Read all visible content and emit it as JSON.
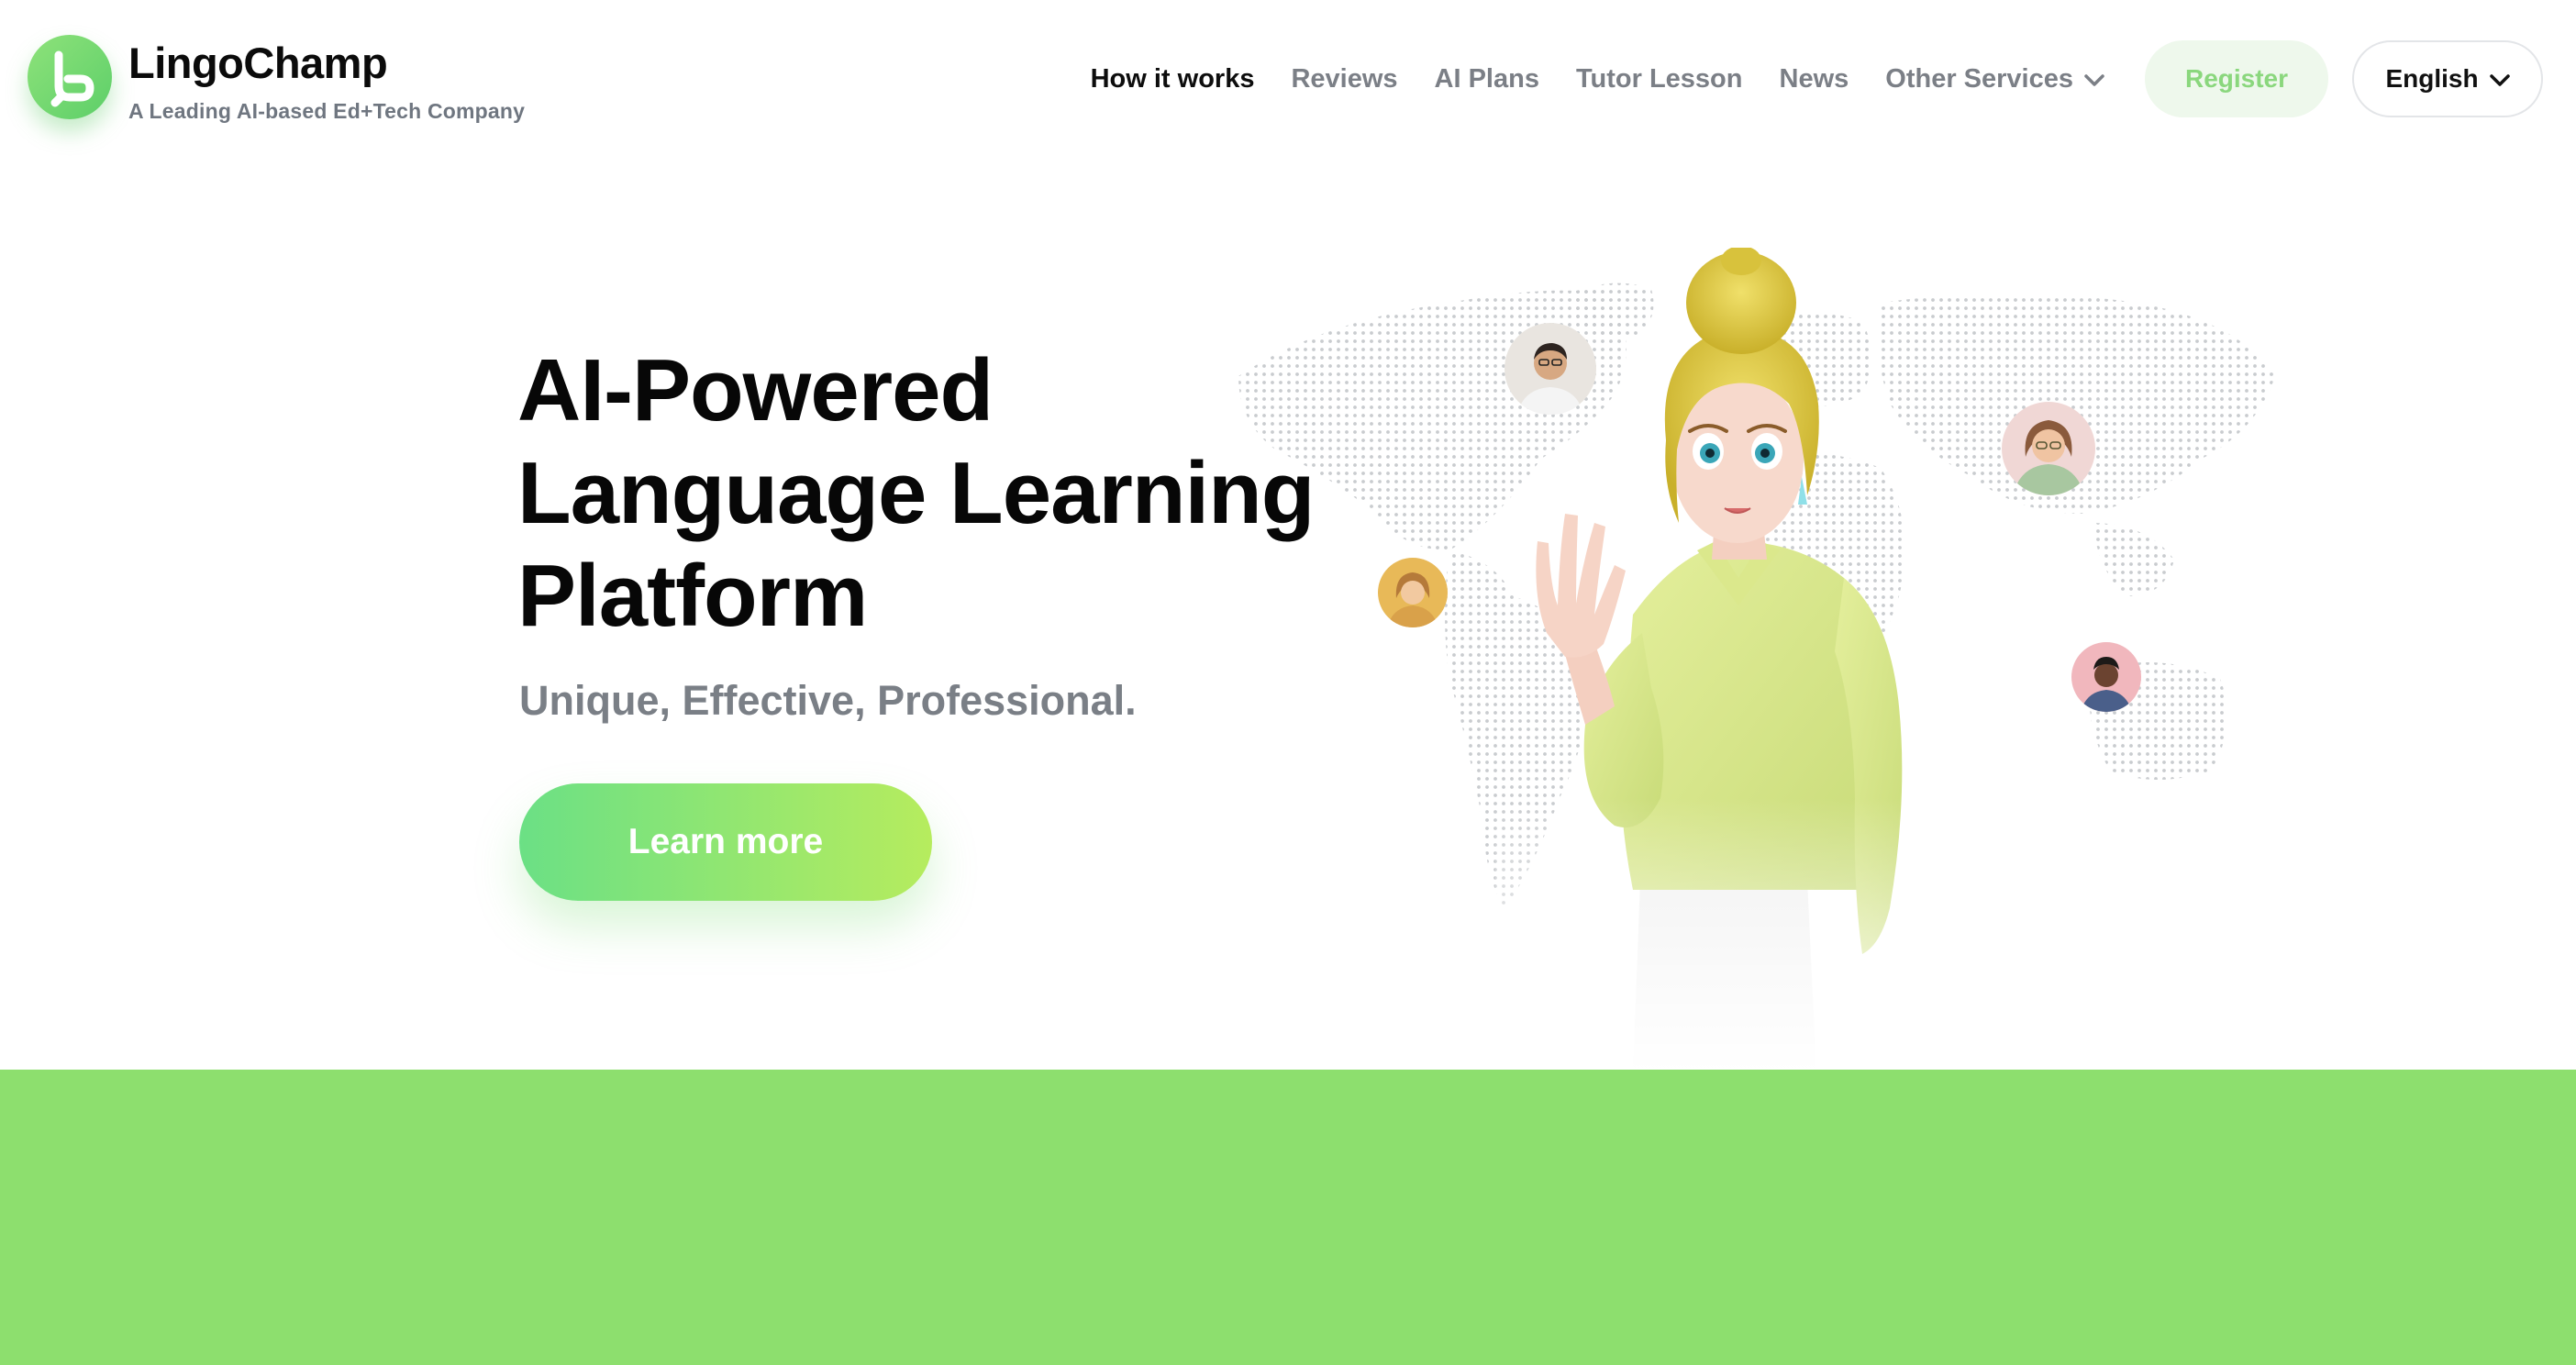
{
  "brand": {
    "name": "LingoChamp",
    "tagline": "A Leading AI-based Ed+Tech Company",
    "logo_icon": "lingochamp-logo-icon"
  },
  "nav": {
    "items": [
      {
        "label": "How it works",
        "active": true
      },
      {
        "label": "Reviews",
        "active": false
      },
      {
        "label": "AI Plans",
        "active": false
      },
      {
        "label": "Tutor Lesson",
        "active": false
      },
      {
        "label": "News",
        "active": false
      },
      {
        "label": "Other Services",
        "active": false,
        "icon": "chevron-down-icon"
      }
    ],
    "register_label": "Register",
    "language_label": "English",
    "language_icon": "chevron-down-icon"
  },
  "hero": {
    "title_lines": [
      "AI-Powered",
      "Language Learning",
      "Platform"
    ],
    "subtitle": "Unique, Effective, Professional.",
    "cta_label": "Learn more"
  },
  "colors": {
    "brand_green": "#8ddf6e",
    "cta_gradient_start": "#6be085",
    "cta_gradient_end": "#b6ec5e",
    "register_bg": "#eef8ec",
    "register_text": "#8ad77d",
    "muted_text": "#7b7f86"
  }
}
